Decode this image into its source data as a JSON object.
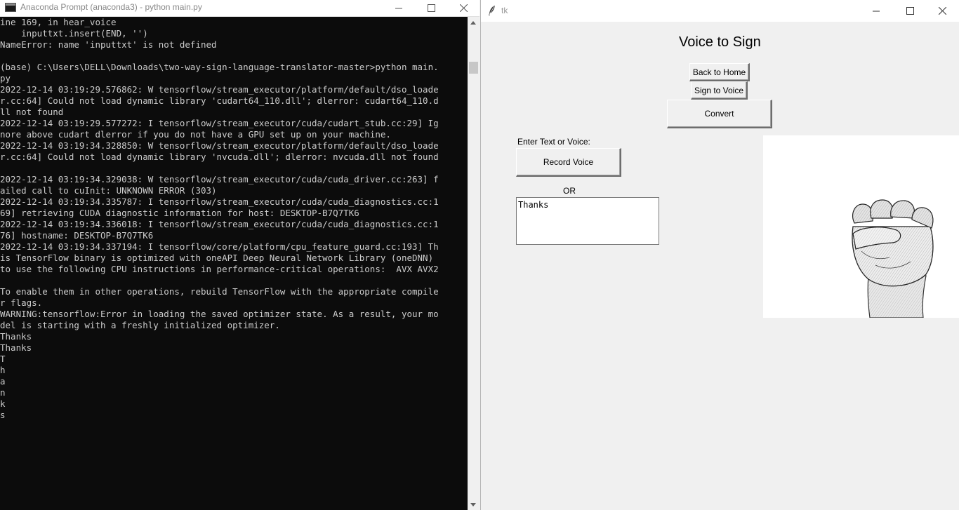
{
  "console": {
    "title": "Anaconda Prompt (anaconda3) - python  main.py",
    "lines": [
      "ine 169, in hear_voice",
      "    inputtxt.insert(END, '')",
      "NameError: name 'inputtxt' is not defined",
      "",
      "(base) C:\\Users\\DELL\\Downloads\\two-way-sign-language-translator-master>python main.",
      "py",
      "2022-12-14 03:19:29.576862: W tensorflow/stream_executor/platform/default/dso_loade",
      "r.cc:64] Could not load dynamic library 'cudart64_110.dll'; dlerror: cudart64_110.d",
      "ll not found",
      "2022-12-14 03:19:29.577272: I tensorflow/stream_executor/cuda/cudart_stub.cc:29] Ig",
      "nore above cudart dlerror if you do not have a GPU set up on your machine.",
      "2022-12-14 03:19:34.328850: W tensorflow/stream_executor/platform/default/dso_loade",
      "r.cc:64] Could not load dynamic library 'nvcuda.dll'; dlerror: nvcuda.dll not found",
      "",
      "2022-12-14 03:19:34.329038: W tensorflow/stream_executor/cuda/cuda_driver.cc:263] f",
      "ailed call to cuInit: UNKNOWN ERROR (303)",
      "2022-12-14 03:19:34.335787: I tensorflow/stream_executor/cuda/cuda_diagnostics.cc:1",
      "69] retrieving CUDA diagnostic information for host: DESKTOP-B7Q7TK6",
      "2022-12-14 03:19:34.336018: I tensorflow/stream_executor/cuda/cuda_diagnostics.cc:1",
      "76] hostname: DESKTOP-B7Q7TK6",
      "2022-12-14 03:19:34.337194: I tensorflow/core/platform/cpu_feature_guard.cc:193] Th",
      "is TensorFlow binary is optimized with oneAPI Deep Neural Network Library (oneDNN)",
      "to use the following CPU instructions in performance-critical operations:  AVX AVX2",
      "",
      "To enable them in other operations, rebuild TensorFlow with the appropriate compile",
      "r flags.",
      "WARNING:tensorflow:Error in loading the saved optimizer state. As a result, your mo",
      "del is starting with a freshly initialized optimizer.",
      "Thanks",
      "Thanks",
      "T",
      "h",
      "a",
      "n",
      "k",
      "s"
    ]
  },
  "tk": {
    "title": "tk",
    "heading": "Voice to Sign",
    "back_home_label": "Back to Home",
    "sign_to_voice_label": "Sign to Voice",
    "convert_label": "Convert",
    "enter_label": "Enter Text or Voice:",
    "record_label": "Record Voice",
    "or_label": "OR",
    "input_text": "Thanks"
  },
  "icons": {
    "console_icon": "terminal-icon",
    "tk_icon": "feather-icon",
    "sign_image": "fist-hand-sign-icon"
  }
}
